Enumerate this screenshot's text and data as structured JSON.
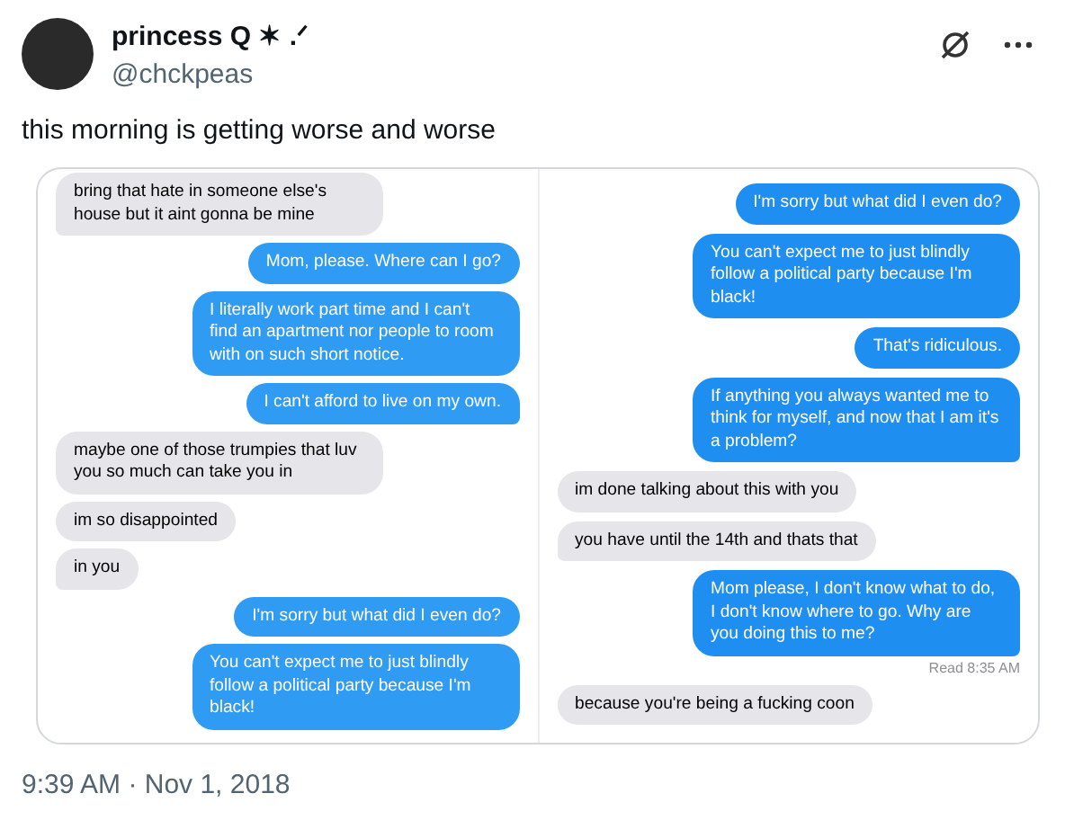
{
  "author": {
    "name": "princess Q ✶ .ᐟ",
    "handle": "@chckpeas"
  },
  "text": "this morning is getting worse and worse",
  "screenshots": [
    {
      "messages": [
        {
          "kind": "received",
          "text": "bring that hate in someone else's house but it aint gonna be mine",
          "tail": true
        },
        {
          "kind": "sent",
          "text": "Mom, please. Where can I go?",
          "tail": false
        },
        {
          "kind": "sent",
          "text": "I literally work part time and I can't find an apartment nor people to room with on such short notice.",
          "tail": false
        },
        {
          "kind": "sent",
          "text": "I can't afford to live on my own.",
          "tail": true
        },
        {
          "kind": "received",
          "text": "maybe one of those trumpies that luv you so much can take you in",
          "tail": false
        },
        {
          "kind": "received",
          "text": "im so disappointed",
          "tail": false
        },
        {
          "kind": "received",
          "text": "in you",
          "tail": true
        },
        {
          "kind": "sent",
          "text": "I'm sorry but what did I even do?",
          "tail": false
        },
        {
          "kind": "sent",
          "text": "You can't expect me to just blindly follow a political party because I'm black!",
          "tail": false
        }
      ]
    },
    {
      "messages": [
        {
          "kind": "sent",
          "text": "I'm sorry but what did I even do?",
          "tail": false
        },
        {
          "kind": "sent",
          "text": "You can't expect me to just blindly follow a political party because I'm black!",
          "tail": false
        },
        {
          "kind": "sent",
          "text": "That's ridiculous.",
          "tail": false
        },
        {
          "kind": "sent",
          "text": "If anything you always wanted me to think for myself, and now that I am it's a problem?",
          "tail": true
        },
        {
          "kind": "received",
          "text": "im done talking about this with you",
          "tail": false
        },
        {
          "kind": "received",
          "text": "you have until the 14th and thats that",
          "tail": true
        },
        {
          "kind": "sent",
          "text": "Mom please, I don't know what to do, I don't know where to go. Why are you doing this to me?",
          "tail": true
        },
        {
          "kind": "receipt",
          "text": "Read 8:35 AM"
        },
        {
          "kind": "received",
          "text": "because you're being a fucking coon",
          "tail": false
        }
      ]
    }
  ],
  "timestamp": "9:39 AM · Nov 1, 2018"
}
